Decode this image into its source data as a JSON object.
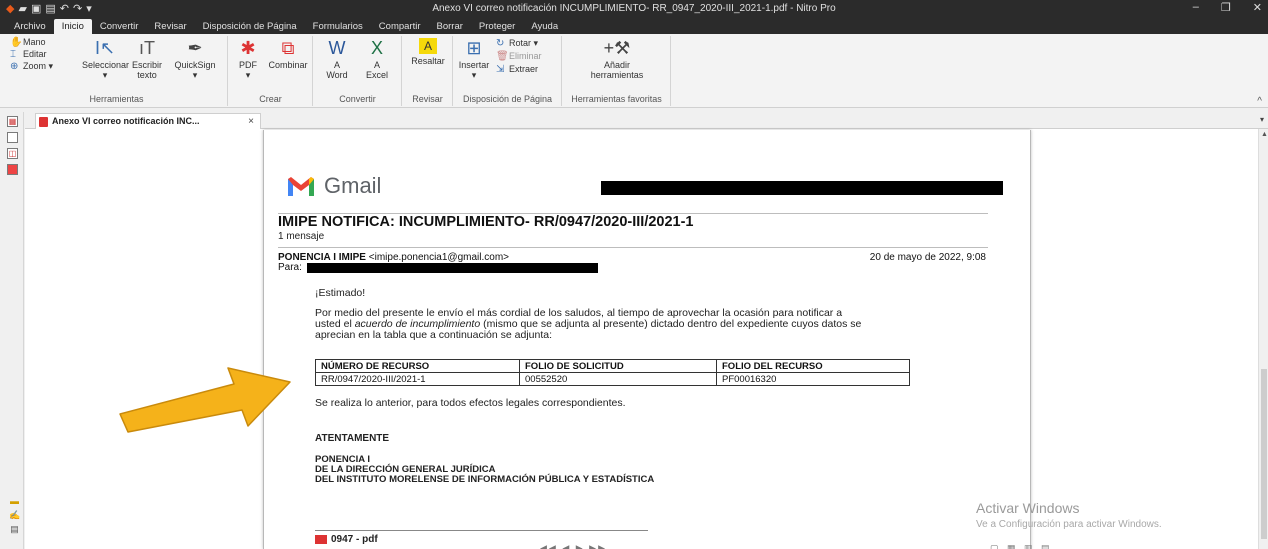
{
  "window": {
    "title": "Anexo VI  correo notificación INCUMPLIMIENTO- RR_0947_2020-III_2021-1.pdf - Nitro Pro"
  },
  "ribbon_tabs": [
    "Archivo",
    "Inicio",
    "Convertir",
    "Revisar",
    "Disposición de Página",
    "Formularios",
    "Compartir",
    "Borrar",
    "Proteger",
    "Ayuda"
  ],
  "ribbon": {
    "herramientas": {
      "mano": "Mano",
      "editar": "Editar",
      "zoom": "Zoom",
      "seleccionar": "Seleccionar",
      "escribir": "Escribir",
      "texto": "texto",
      "quicksign": "QuickSign",
      "label": "Herramientas"
    },
    "crear": {
      "pdf": "PDF",
      "combinar": "Combinar",
      "label": "Crear"
    },
    "convertir": {
      "a_word_1": "A",
      "a_word_2": "Word",
      "a_excel_1": "A",
      "a_excel_2": "Excel",
      "label": "Convertir"
    },
    "revisar": {
      "resaltar": "Resaltar",
      "label": "Revisar"
    },
    "disposicion": {
      "insertar": "Insertar",
      "rotar": "Rotar",
      "eliminar": "Eliminar",
      "extraer": "Extraer",
      "label": "Disposición de Página"
    },
    "favoritas": {
      "anadir_1": "Añadir",
      "anadir_2": "herramientas",
      "label": "Herramientas favoritas"
    }
  },
  "doc_tab": {
    "label": "Anexo VI  correo notificación INC...",
    "close": "×"
  },
  "email": {
    "brand": "Gmail",
    "subject": "IMIPE NOTIFICA: INCUMPLIMIENTO- RR/0947/2020-III/2021-1",
    "message_count": "1 mensaje",
    "sender_name": "PONENCIA I IMIPE",
    "sender_email": "<imipe.ponencia1@gmail.com>",
    "date": "20 de mayo de 2022, 9:08",
    "to_label": "Para:",
    "greeting": "¡Estimado!",
    "para1_a": "Por medio del presente le envío el más cordial de los saludos, al tiempo de aprovechar la ocasión para notificar a",
    "para1_b_pre": "usted el ",
    "para1_b_em": "acuerdo de incumplimiento",
    "para1_b_post": " (mismo que se adjunta al presente) dictado dentro del expediente cuyos datos se",
    "para1_c": "aprecian en la tabla que a continuación se adjunta:",
    "table": {
      "headers": [
        "NÚMERO DE RECURSO",
        "FOLIO DE SOLICITUD",
        "FOLIO DEL RECURSO"
      ],
      "row": [
        "RR/0947/2020-III/2021-1",
        "00552520",
        "PF00016320"
      ]
    },
    "closing_line": "Se realiza lo anterior, para todos efectos legales correspondientes.",
    "atentamente": "ATENTAMENTE",
    "sig1": "PONENCIA I",
    "sig2": "DE LA DIRECCIÓN GENERAL JURÍDICA",
    "sig3": "DEL INSTITUTO MORELENSE DE INFORMACIÓN PÚBLICA Y ESTADÍSTICA",
    "attachment": "0947 - pdf"
  },
  "watermark": {
    "line1": "Activar Windows",
    "line2": "Ve a Configuración para activar Windows."
  },
  "colors": {
    "arrow_fill": "#f5b21a",
    "arrow_stroke": "#c98a0c",
    "titlebar": "#2b2b2b"
  }
}
